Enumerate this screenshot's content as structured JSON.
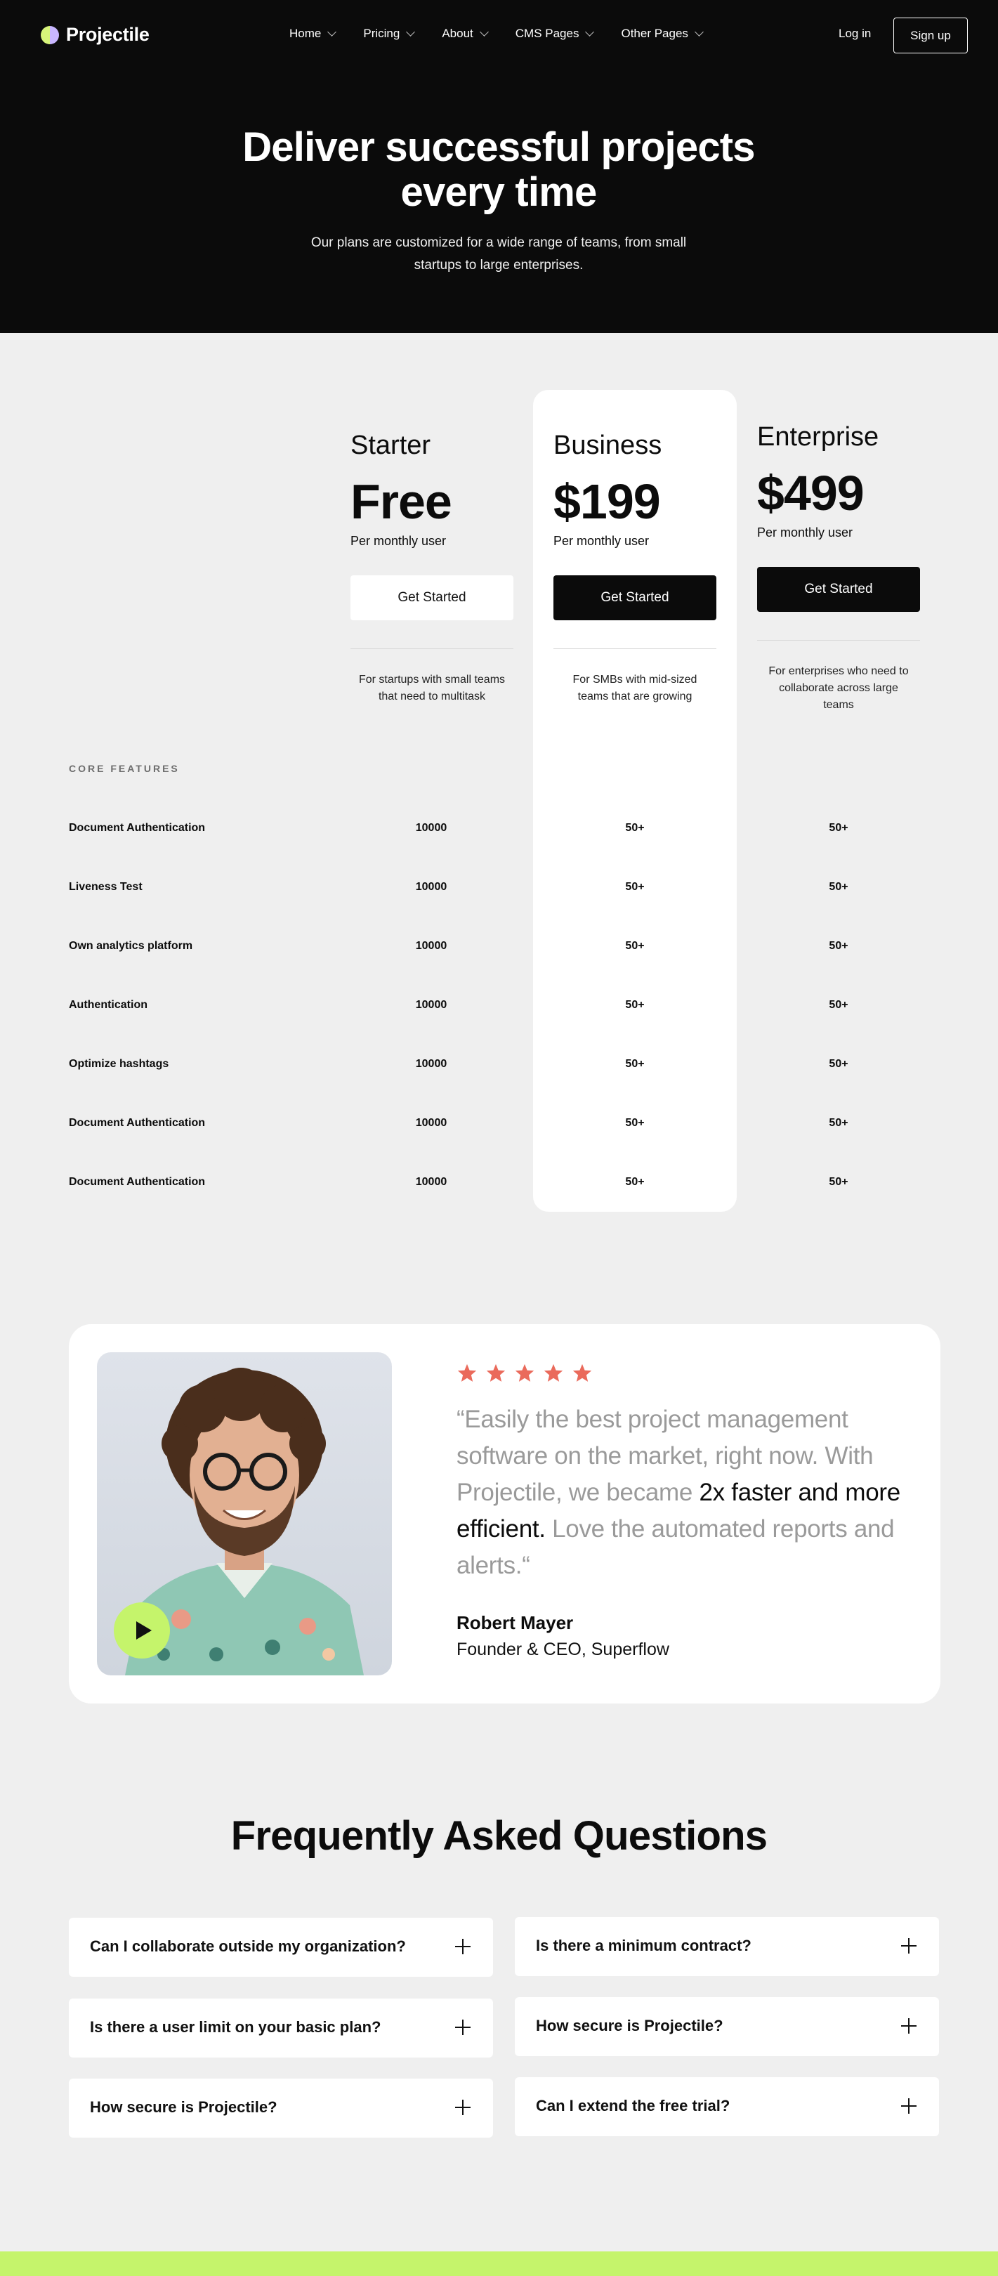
{
  "brand": {
    "name": "Projectile"
  },
  "nav": {
    "items": [
      "Home",
      "Pricing",
      "About",
      "CMS Pages",
      "Other Pages"
    ],
    "login": "Log in",
    "signup": "Sign up"
  },
  "hero": {
    "title_line1": "Deliver successful projects",
    "title_line2": "every time",
    "subtitle": "Our plans are customized for a wide range of teams, from small startups to large enterprises."
  },
  "plans": [
    {
      "name": "Starter",
      "price": "Free",
      "per": "Per monthly user",
      "cta": "Get Started",
      "desc": "For startups with small teams that need to multitask"
    },
    {
      "name": "Business",
      "price": "$199",
      "per": "Per monthly user",
      "cta": "Get Started",
      "desc": "For SMBs with mid-sized teams that are growing"
    },
    {
      "name": "Enterprise",
      "price": "$499",
      "per": "Per monthly user",
      "cta": "Get Started",
      "desc": "For enterprises who need to collaborate across large teams"
    }
  ],
  "features": {
    "label": "CORE FEATURES",
    "rows": [
      {
        "name": "Document Authentication",
        "starter": "10000",
        "business": "50+",
        "enterprise": "50+"
      },
      {
        "name": "Liveness Test",
        "starter": "10000",
        "business": "50+",
        "enterprise": "50+"
      },
      {
        "name": "Own analytics platform",
        "starter": "10000",
        "business": "50+",
        "enterprise": "50+"
      },
      {
        "name": "Authentication",
        "starter": "10000",
        "business": "50+",
        "enterprise": "50+"
      },
      {
        "name": "Optimize hashtags",
        "starter": "10000",
        "business": "50+",
        "enterprise": "50+"
      },
      {
        "name": "Document Authentication",
        "starter": "10000",
        "business": "50+",
        "enterprise": "50+"
      },
      {
        "name": "Document Authentication",
        "starter": "10000",
        "business": "50+",
        "enterprise": "50+"
      }
    ]
  },
  "testimonial": {
    "rating": 5,
    "star_color": "#ea6a5b",
    "quote_part1": "“Easily the best project management software on the market, right now. With Projectile, we became ",
    "quote_highlight": "2x faster and more efficient.",
    "quote_part2": " Love the automated reports and alerts.“",
    "name": "Robert Mayer",
    "role": "Founder & CEO, Superflow",
    "play_icon": "play-icon"
  },
  "faq": {
    "title": "Frequently Asked Questions",
    "left": [
      "Can I collaborate outside my organization?",
      "Is there a user limit on your basic plan?",
      "How secure is Projectile?"
    ],
    "right": [
      "Is there a minimum contract?",
      "How secure is Projectile?",
      "Can I extend the free trial?"
    ]
  },
  "colors": {
    "accent": "#c5f46b",
    "dark": "#0b0b0b",
    "bg": "#efefef"
  }
}
